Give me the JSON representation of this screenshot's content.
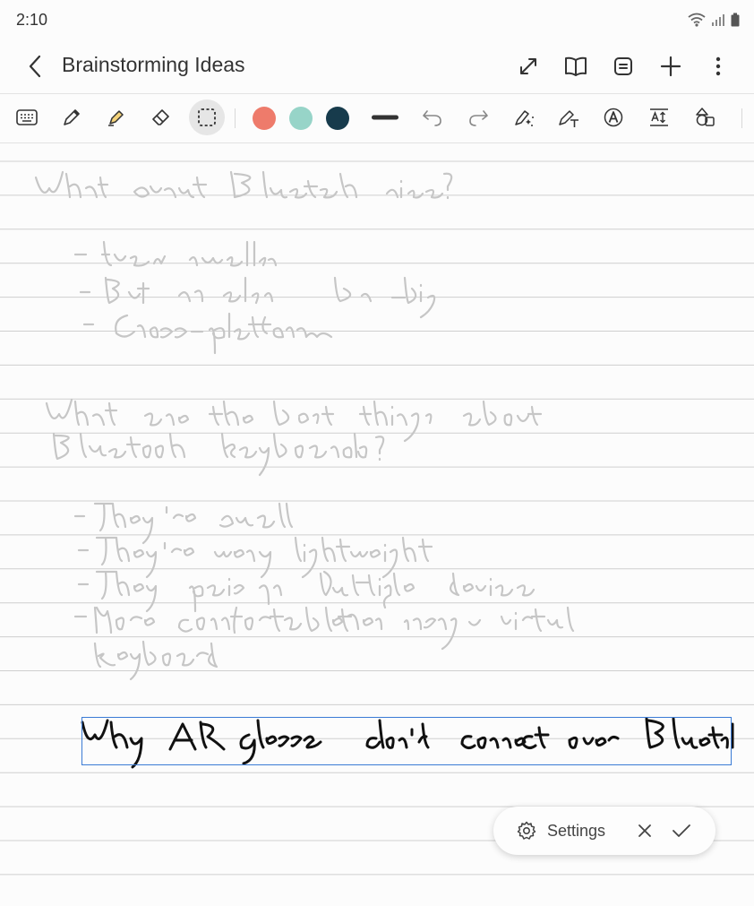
{
  "status_bar": {
    "time": "2:10"
  },
  "header": {
    "title": "Brainstorming Ideas"
  },
  "toolbar": {
    "colors": [
      "#ee7b6b",
      "#97d4c8",
      "#173b4c"
    ]
  },
  "settings_pill": {
    "label": "Settings"
  }
}
